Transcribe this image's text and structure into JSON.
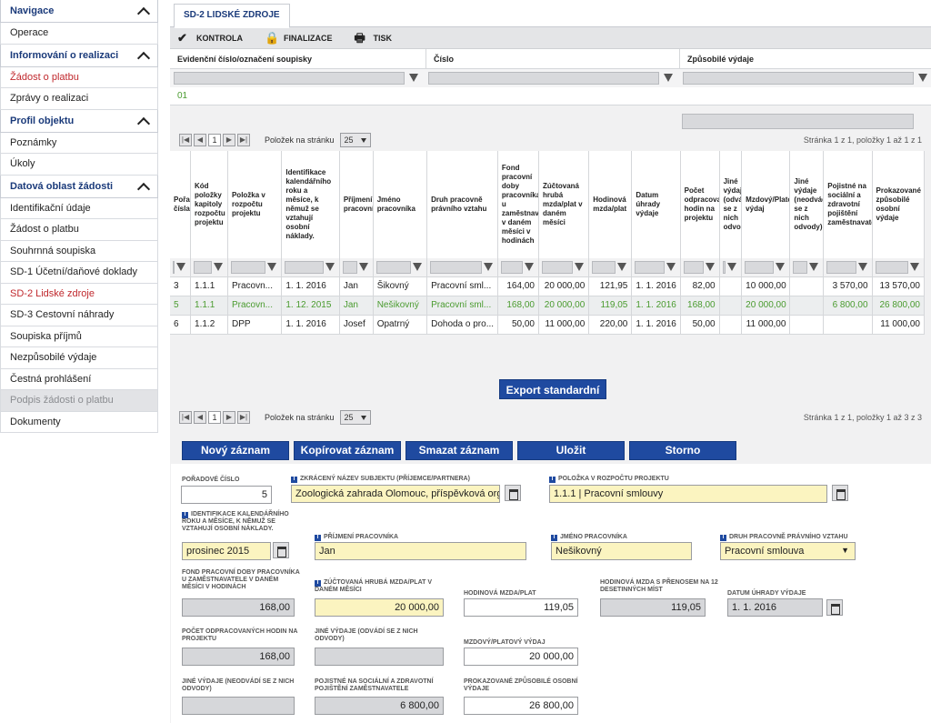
{
  "sidebar": {
    "sections": [
      {
        "title": "Navigace",
        "items": [
          {
            "label": "Operace"
          }
        ]
      },
      {
        "title": "Informování o realizaci",
        "items": [
          {
            "label": "Žádost o platbu",
            "active": true
          },
          {
            "label": "Zprávy o realizaci"
          }
        ]
      },
      {
        "title": "Profil objektu",
        "items": [
          {
            "label": "Poznámky"
          },
          {
            "label": "Úkoly"
          }
        ]
      },
      {
        "title": "Datová oblast žádosti",
        "items": [
          {
            "label": "Identifikační údaje"
          },
          {
            "label": "Žádost o platbu"
          },
          {
            "label": "Souhrnná soupiska"
          },
          {
            "label": "SD-1 Účetní/daňové doklady"
          },
          {
            "label": "SD-2 Lidské zdroje",
            "active": true
          },
          {
            "label": "SD-3 Cestovní náhrady"
          },
          {
            "label": "Soupiska příjmů"
          },
          {
            "label": "Nezpůsobilé výdaje"
          },
          {
            "label": "Čestná prohlášení"
          },
          {
            "label": "Podpis žádosti o platbu",
            "disabled": true
          },
          {
            "label": "Dokumenty"
          }
        ]
      }
    ]
  },
  "tab": {
    "label": "SD-2 LIDSKÉ ZDROJE"
  },
  "toolbar": {
    "kontrola": "KONTROLA",
    "finalizace": "FINALIZACE",
    "tisk": "TISK"
  },
  "grid1": {
    "headers": [
      "Evidenční číslo/označení soupisky",
      "Číslo",
      "Způsobilé výdaje"
    ],
    "row_value": "01"
  },
  "pager": {
    "per_page_label": "Položek na stránku",
    "per_page": "25",
    "page": "1",
    "info_top": "Stránka 1 z 1, položky 1 až 1 z 1",
    "info_bottom": "Stránka 1 z 1, položky 1 až 3 z 3"
  },
  "table": {
    "headers": [
      "Pořadí čísla",
      "Kód položky kapitoly rozpočtu projektu",
      "Položka v rozpočtu projektu",
      "Identifikace kalendářního roku a měsíce, k němuž se vztahují osobní náklady.",
      "Příjmení pracovníka",
      "Jméno pracovníka",
      "Druh pracovně právního vztahu",
      "Fond pracovní doby pracovníka u zaměstnavatele v daném měsíci v hodinách",
      "Zúčtovaná hrubá mzda/plat v daném měsíci",
      "Hodinová mzda/plat",
      "Datum úhrady výdaje",
      "Počet odpracovaných hodin na projektu",
      "Jiné výdaje (odvádí se z nich odvody)",
      "Mzdový/Platový výdaj",
      "Jiné výdaje (neodvádí se z nich odvody)",
      "Pojistné na sociální a zdravotní pojištění zaměstnavatele",
      "Prokazované způsobilé osobní výdaje"
    ],
    "rows": [
      [
        "3",
        "1.1.1",
        "Pracovn...",
        "1. 1. 2016",
        "Jan",
        "Šikovný",
        "Pracovní sml...",
        "164,00",
        "20 000,00",
        "121,95",
        "1. 1. 2016",
        "82,00",
        "",
        "10 000,00",
        "",
        "3 570,00",
        "13 570,00"
      ],
      [
        "5",
        "1.1.1",
        "Pracovn...",
        "1. 12. 2015",
        "Jan",
        "Nešikovný",
        "Pracovní sml...",
        "168,00",
        "20 000,00",
        "119,05",
        "1. 1. 2016",
        "168,00",
        "",
        "20 000,00",
        "",
        "6 800,00",
        "26 800,00"
      ],
      [
        "6",
        "1.1.2",
        "DPP",
        "1. 1. 2016",
        "Josef",
        "Opatrný",
        "Dohoda o pro...",
        "50,00",
        "11 000,00",
        "220,00",
        "1. 1. 2016",
        "50,00",
        "",
        "11 000,00",
        "",
        "",
        "11 000,00"
      ]
    ]
  },
  "export_label": "Export standardní",
  "actions": {
    "new": "Nový záznam",
    "copy": "Kopírovat záznam",
    "delete": "Smazat záznam",
    "save": "Uložit",
    "cancel": "Storno"
  },
  "form": {
    "poradove_cislo": {
      "label": "Pořadové číslo",
      "value": "5"
    },
    "subjekt": {
      "label": "Zkrácený název subjektu (příjemce/partnera)",
      "value": "Zoologická zahrada Olomouc, příspěvková organiz"
    },
    "polozka": {
      "label": "Položka v rozpočtu projektu",
      "value": "1.1.1 | Pracovní smlouvy"
    },
    "identifikace": {
      "label": "Identifikace kalendářního roku a měsíce, k němuž se vztahují osobní náklady.",
      "value": "prosinec 2015"
    },
    "prijmeni": {
      "label": "Příjmení pracovníka",
      "value": "Jan"
    },
    "jmeno": {
      "label": "Jméno pracovníka",
      "value": "Nešikovný"
    },
    "druh": {
      "label": "Druh pracovně právního vztahu",
      "value": "Pracovní smlouva"
    },
    "fond": {
      "label": "Fond pracovní doby pracovníka u zaměstnavatele v daném měsíci v hodinách",
      "value": "168,00"
    },
    "hruba_mzda": {
      "label": "Zúčtovaná hrubá mzda/plat v daném měsíci",
      "value": "20 000,00"
    },
    "hodinova": {
      "label": "Hodinová mzda/plat",
      "value": "119,05"
    },
    "hodinova12": {
      "label": "Hodinová mzda s přenosem na 12 desetinných míst",
      "value": "119,05"
    },
    "datum": {
      "label": "Datum úhrady výdaje",
      "value": "1. 1. 2016"
    },
    "pocet": {
      "label": "Počet odpracovaných hodin na projektu",
      "value": "168,00"
    },
    "jine_odvody": {
      "label": "Jiné výdaje (odvádí se z nich odvody)",
      "value": ""
    },
    "mzdovy": {
      "label": "Mzdový/platový výdaj",
      "value": "20 000,00"
    },
    "jine_neodvody": {
      "label": "Jiné výdaje (neodvádí se z nich odvody)",
      "value": ""
    },
    "pojistne": {
      "label": "Pojistné na sociální a zdravotní pojištění zaměstnavatele",
      "value": "6 800,00"
    },
    "prokazovane": {
      "label": "Prokazované způsobilé osobní výdaje",
      "value": "26 800,00"
    }
  },
  "colors": {
    "accent": "#1f4aa0",
    "active_link": "#c0282d",
    "green_text": "#4a9b2f",
    "required_field": "#fbf4c0"
  }
}
